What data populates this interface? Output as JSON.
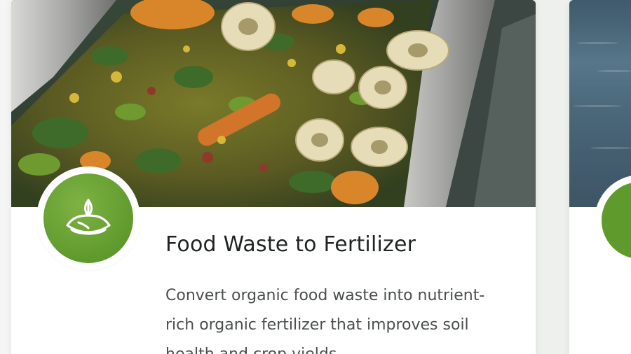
{
  "card": {
    "title": "Food Waste to Fertilizer",
    "description": "Convert organic food waste into nutrient-rich organic fertilizer that improves soil health and crop yields",
    "image": "food-waste-conveyor-image",
    "icon": "compost-leaf-icon"
  },
  "colors": {
    "accent": "#5f9a2d",
    "title": "#1f2421",
    "text": "#4a4f4c",
    "background": "#eef0ee"
  },
  "next_card": {
    "image": "water-surface-image",
    "icon": "green-circle-icon"
  }
}
